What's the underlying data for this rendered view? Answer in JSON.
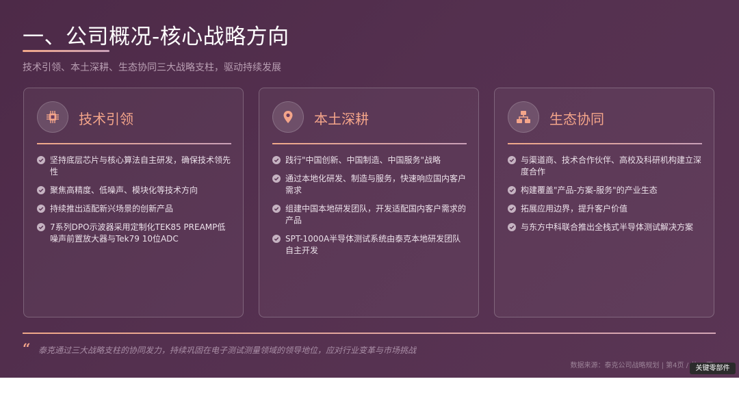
{
  "header": {
    "title": "一、公司概况-核心战略方向",
    "subtitle": "技术引领、本土深耕、生态协同三大战略支柱，驱动持续发展"
  },
  "colors": {
    "accent": "#f4a58a",
    "background": "#54304f",
    "text": "#ece1ea"
  },
  "cards": [
    {
      "icon": "chip-icon",
      "title": "技术引领",
      "items": [
        "坚持底层芯片与核心算法自主研发，确保技术领先性",
        "聚焦高精度、低噪声、模块化等技术方向",
        "持续推出适配新兴场景的创新产品",
        "7系列DPO示波器采用定制化TEK85 PREAMP低噪声前置放大器与Tek79 10位ADC"
      ]
    },
    {
      "icon": "location-pin-icon",
      "title": "本土深耕",
      "items": [
        "践行\"中国创新、中国制造、中国服务\"战略",
        "通过本地化研发、制造与服务，快速响应国内客户需求",
        "组建中国本地研发团队，开发适配国内客户需求的产品",
        "SPT-1000A半导体测试系统由泰克本地研发团队自主开发"
      ]
    },
    {
      "icon": "network-icon",
      "title": "生态协同",
      "items": [
        "与渠道商、技术合作伙伴、高校及科研机构建立深度合作",
        "构建覆盖\"产品-方案-服务\"的产业生态",
        "拓展应用边界，提升客户价值",
        "与东方中科联合推出全栈式半导体测试解决方案"
      ]
    }
  ],
  "footer": {
    "quote": "泰克通过三大战略支柱的协同发力，持续巩固在电子测试测量领域的领导地位，应对行业变革与市场挑战",
    "source": "数据来源：泰克公司战略规划 | 第4页 / 共35页",
    "watermark": "关键零部件"
  }
}
